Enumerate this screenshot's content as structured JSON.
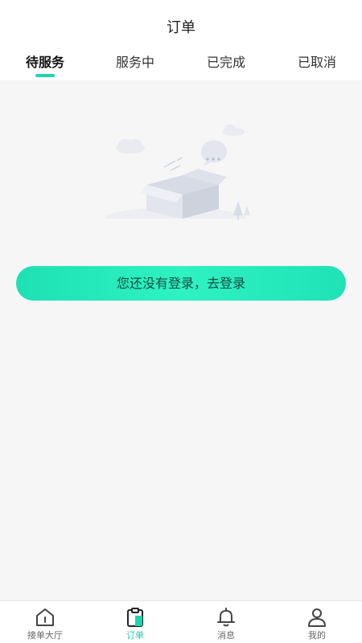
{
  "header": {
    "title": "订单"
  },
  "tabs": [
    {
      "label": "待服务",
      "active": true
    },
    {
      "label": "服务中",
      "active": false
    },
    {
      "label": "已完成",
      "active": false
    },
    {
      "label": "已取消",
      "active": false
    }
  ],
  "empty_state": {
    "illustration": "empty-box-icon",
    "login_button_label": "您还没有登录，去登录"
  },
  "bottom_nav": [
    {
      "label": "接单大厅",
      "icon": "home-icon",
      "active": false
    },
    {
      "label": "订单",
      "icon": "order-clipboard-icon",
      "active": true
    },
    {
      "label": "消息",
      "icon": "bell-icon",
      "active": false
    },
    {
      "label": "我的",
      "icon": "user-icon",
      "active": false
    }
  ],
  "colors": {
    "accent": "#1fd3b2",
    "button_start": "#1ee0b3",
    "button_end": "#2ff2c2",
    "background": "#f6f6f6"
  }
}
